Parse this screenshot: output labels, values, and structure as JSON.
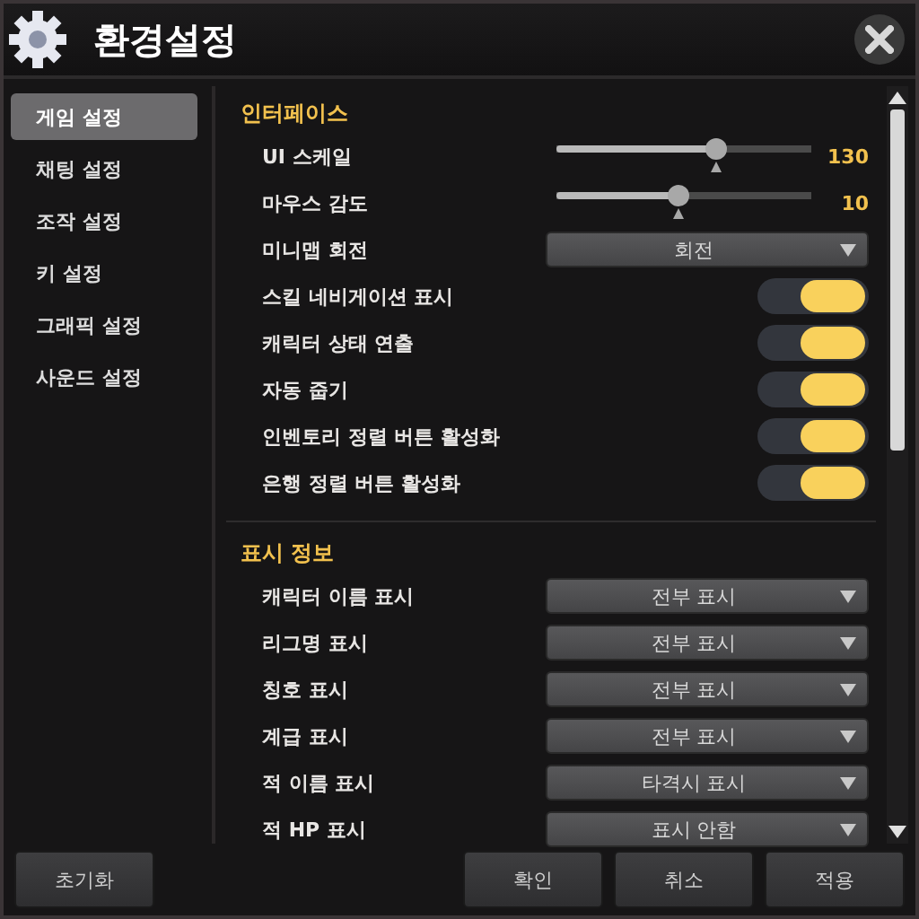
{
  "window": {
    "title": "환경설정"
  },
  "sidebar": {
    "items": [
      {
        "label": "게임 설정",
        "selected": true
      },
      {
        "label": "채팅 설정",
        "selected": false
      },
      {
        "label": "조작 설정",
        "selected": false
      },
      {
        "label": "키 설정",
        "selected": false
      },
      {
        "label": "그래픽 설정",
        "selected": false
      },
      {
        "label": "사운드 설정",
        "selected": false
      }
    ]
  },
  "sections": [
    {
      "title": "인터페이스",
      "rows": [
        {
          "kind": "slider",
          "label": "UI 스케일",
          "level": 0.62,
          "reading": "130"
        },
        {
          "kind": "slider",
          "label": "마우스 감도",
          "level": 0.47,
          "reading": "10"
        },
        {
          "kind": "dropdown",
          "label": "미니맵 회전",
          "value": "회전"
        },
        {
          "kind": "toggle",
          "label": "스킬 네비게이션 표시",
          "on": true
        },
        {
          "kind": "toggle",
          "label": "캐릭터 상태 연출",
          "on": true
        },
        {
          "kind": "toggle",
          "label": "자동 줍기",
          "on": true
        },
        {
          "kind": "toggle",
          "label": "인벤토리 정렬 버튼 활성화",
          "on": true
        },
        {
          "kind": "toggle",
          "label": "은행 정렬 버튼 활성화",
          "on": true
        }
      ]
    },
    {
      "title": "표시 정보",
      "rows": [
        {
          "kind": "dropdown",
          "label": "캐릭터 이름 표시",
          "value": "전부 표시"
        },
        {
          "kind": "dropdown",
          "label": "리그명 표시",
          "value": "전부 표시"
        },
        {
          "kind": "dropdown",
          "label": "칭호 표시",
          "value": "전부 표시"
        },
        {
          "kind": "dropdown",
          "label": "계급 표시",
          "value": "전부 표시"
        },
        {
          "kind": "dropdown",
          "label": "적 이름 표시",
          "value": "타격시 표시"
        },
        {
          "kind": "dropdown",
          "label": "적 HP 표시",
          "value": "표시 안함"
        }
      ]
    }
  ],
  "buttons": {
    "reset": "초기화",
    "actions": [
      "확인",
      "취소",
      "적용"
    ]
  }
}
